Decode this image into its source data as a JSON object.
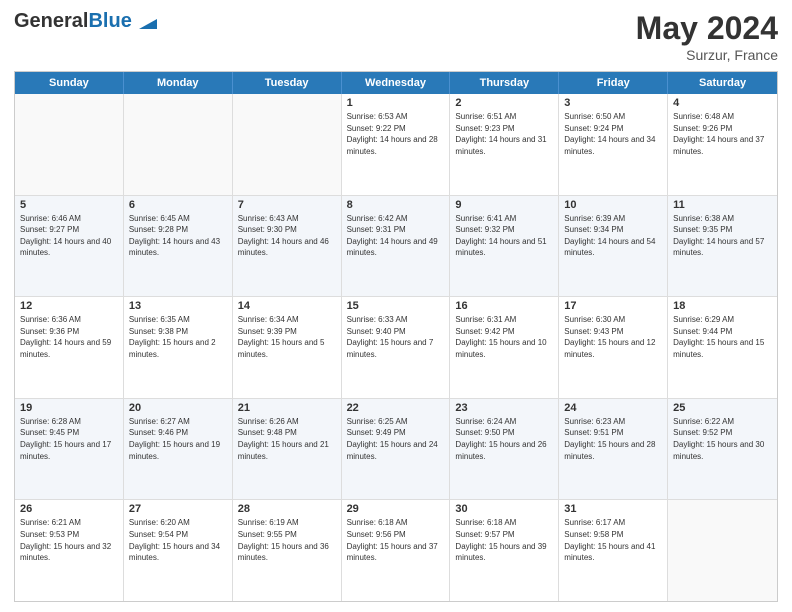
{
  "header": {
    "logo_general": "General",
    "logo_blue": "Blue",
    "month_year": "May 2024",
    "location": "Surzur, France"
  },
  "days_of_week": [
    "Sunday",
    "Monday",
    "Tuesday",
    "Wednesday",
    "Thursday",
    "Friday",
    "Saturday"
  ],
  "weeks": [
    {
      "alt": false,
      "cells": [
        {
          "day": "",
          "empty": true,
          "sunrise": "",
          "sunset": "",
          "daylight": ""
        },
        {
          "day": "",
          "empty": true,
          "sunrise": "",
          "sunset": "",
          "daylight": ""
        },
        {
          "day": "",
          "empty": true,
          "sunrise": "",
          "sunset": "",
          "daylight": ""
        },
        {
          "day": "1",
          "empty": false,
          "sunrise": "Sunrise: 6:53 AM",
          "sunset": "Sunset: 9:22 PM",
          "daylight": "Daylight: 14 hours and 28 minutes."
        },
        {
          "day": "2",
          "empty": false,
          "sunrise": "Sunrise: 6:51 AM",
          "sunset": "Sunset: 9:23 PM",
          "daylight": "Daylight: 14 hours and 31 minutes."
        },
        {
          "day": "3",
          "empty": false,
          "sunrise": "Sunrise: 6:50 AM",
          "sunset": "Sunset: 9:24 PM",
          "daylight": "Daylight: 14 hours and 34 minutes."
        },
        {
          "day": "4",
          "empty": false,
          "sunrise": "Sunrise: 6:48 AM",
          "sunset": "Sunset: 9:26 PM",
          "daylight": "Daylight: 14 hours and 37 minutes."
        }
      ]
    },
    {
      "alt": true,
      "cells": [
        {
          "day": "5",
          "empty": false,
          "sunrise": "Sunrise: 6:46 AM",
          "sunset": "Sunset: 9:27 PM",
          "daylight": "Daylight: 14 hours and 40 minutes."
        },
        {
          "day": "6",
          "empty": false,
          "sunrise": "Sunrise: 6:45 AM",
          "sunset": "Sunset: 9:28 PM",
          "daylight": "Daylight: 14 hours and 43 minutes."
        },
        {
          "day": "7",
          "empty": false,
          "sunrise": "Sunrise: 6:43 AM",
          "sunset": "Sunset: 9:30 PM",
          "daylight": "Daylight: 14 hours and 46 minutes."
        },
        {
          "day": "8",
          "empty": false,
          "sunrise": "Sunrise: 6:42 AM",
          "sunset": "Sunset: 9:31 PM",
          "daylight": "Daylight: 14 hours and 49 minutes."
        },
        {
          "day": "9",
          "empty": false,
          "sunrise": "Sunrise: 6:41 AM",
          "sunset": "Sunset: 9:32 PM",
          "daylight": "Daylight: 14 hours and 51 minutes."
        },
        {
          "day": "10",
          "empty": false,
          "sunrise": "Sunrise: 6:39 AM",
          "sunset": "Sunset: 9:34 PM",
          "daylight": "Daylight: 14 hours and 54 minutes."
        },
        {
          "day": "11",
          "empty": false,
          "sunrise": "Sunrise: 6:38 AM",
          "sunset": "Sunset: 9:35 PM",
          "daylight": "Daylight: 14 hours and 57 minutes."
        }
      ]
    },
    {
      "alt": false,
      "cells": [
        {
          "day": "12",
          "empty": false,
          "sunrise": "Sunrise: 6:36 AM",
          "sunset": "Sunset: 9:36 PM",
          "daylight": "Daylight: 14 hours and 59 minutes."
        },
        {
          "day": "13",
          "empty": false,
          "sunrise": "Sunrise: 6:35 AM",
          "sunset": "Sunset: 9:38 PM",
          "daylight": "Daylight: 15 hours and 2 minutes."
        },
        {
          "day": "14",
          "empty": false,
          "sunrise": "Sunrise: 6:34 AM",
          "sunset": "Sunset: 9:39 PM",
          "daylight": "Daylight: 15 hours and 5 minutes."
        },
        {
          "day": "15",
          "empty": false,
          "sunrise": "Sunrise: 6:33 AM",
          "sunset": "Sunset: 9:40 PM",
          "daylight": "Daylight: 15 hours and 7 minutes."
        },
        {
          "day": "16",
          "empty": false,
          "sunrise": "Sunrise: 6:31 AM",
          "sunset": "Sunset: 9:42 PM",
          "daylight": "Daylight: 15 hours and 10 minutes."
        },
        {
          "day": "17",
          "empty": false,
          "sunrise": "Sunrise: 6:30 AM",
          "sunset": "Sunset: 9:43 PM",
          "daylight": "Daylight: 15 hours and 12 minutes."
        },
        {
          "day": "18",
          "empty": false,
          "sunrise": "Sunrise: 6:29 AM",
          "sunset": "Sunset: 9:44 PM",
          "daylight": "Daylight: 15 hours and 15 minutes."
        }
      ]
    },
    {
      "alt": true,
      "cells": [
        {
          "day": "19",
          "empty": false,
          "sunrise": "Sunrise: 6:28 AM",
          "sunset": "Sunset: 9:45 PM",
          "daylight": "Daylight: 15 hours and 17 minutes."
        },
        {
          "day": "20",
          "empty": false,
          "sunrise": "Sunrise: 6:27 AM",
          "sunset": "Sunset: 9:46 PM",
          "daylight": "Daylight: 15 hours and 19 minutes."
        },
        {
          "day": "21",
          "empty": false,
          "sunrise": "Sunrise: 6:26 AM",
          "sunset": "Sunset: 9:48 PM",
          "daylight": "Daylight: 15 hours and 21 minutes."
        },
        {
          "day": "22",
          "empty": false,
          "sunrise": "Sunrise: 6:25 AM",
          "sunset": "Sunset: 9:49 PM",
          "daylight": "Daylight: 15 hours and 24 minutes."
        },
        {
          "day": "23",
          "empty": false,
          "sunrise": "Sunrise: 6:24 AM",
          "sunset": "Sunset: 9:50 PM",
          "daylight": "Daylight: 15 hours and 26 minutes."
        },
        {
          "day": "24",
          "empty": false,
          "sunrise": "Sunrise: 6:23 AM",
          "sunset": "Sunset: 9:51 PM",
          "daylight": "Daylight: 15 hours and 28 minutes."
        },
        {
          "day": "25",
          "empty": false,
          "sunrise": "Sunrise: 6:22 AM",
          "sunset": "Sunset: 9:52 PM",
          "daylight": "Daylight: 15 hours and 30 minutes."
        }
      ]
    },
    {
      "alt": false,
      "cells": [
        {
          "day": "26",
          "empty": false,
          "sunrise": "Sunrise: 6:21 AM",
          "sunset": "Sunset: 9:53 PM",
          "daylight": "Daylight: 15 hours and 32 minutes."
        },
        {
          "day": "27",
          "empty": false,
          "sunrise": "Sunrise: 6:20 AM",
          "sunset": "Sunset: 9:54 PM",
          "daylight": "Daylight: 15 hours and 34 minutes."
        },
        {
          "day": "28",
          "empty": false,
          "sunrise": "Sunrise: 6:19 AM",
          "sunset": "Sunset: 9:55 PM",
          "daylight": "Daylight: 15 hours and 36 minutes."
        },
        {
          "day": "29",
          "empty": false,
          "sunrise": "Sunrise: 6:18 AM",
          "sunset": "Sunset: 9:56 PM",
          "daylight": "Daylight: 15 hours and 37 minutes."
        },
        {
          "day": "30",
          "empty": false,
          "sunrise": "Sunrise: 6:18 AM",
          "sunset": "Sunset: 9:57 PM",
          "daylight": "Daylight: 15 hours and 39 minutes."
        },
        {
          "day": "31",
          "empty": false,
          "sunrise": "Sunrise: 6:17 AM",
          "sunset": "Sunset: 9:58 PM",
          "daylight": "Daylight: 15 hours and 41 minutes."
        },
        {
          "day": "",
          "empty": true,
          "sunrise": "",
          "sunset": "",
          "daylight": ""
        }
      ]
    }
  ]
}
